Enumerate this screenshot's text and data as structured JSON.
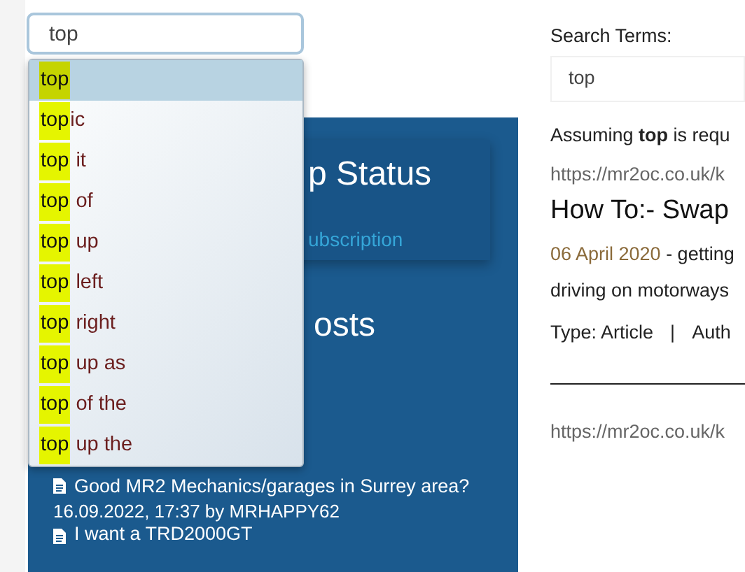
{
  "search": {
    "value": "top"
  },
  "suggestions": [
    {
      "match": "top",
      "selected": true
    },
    {
      "match": "top",
      "rest": "ic",
      "selected": false
    },
    {
      "match": "top",
      "rest": " it",
      "selected": false
    },
    {
      "match": "top",
      "rest": " of",
      "selected": false
    },
    {
      "match": "top",
      "rest": " up",
      "selected": false
    },
    {
      "match": "top",
      "rest": " left",
      "selected": false
    },
    {
      "match": "top",
      "rest": " right",
      "selected": false
    },
    {
      "match": "top",
      "rest": " up as",
      "selected": false
    },
    {
      "match": "top",
      "rest": " of the",
      "selected": false
    },
    {
      "match": "top",
      "rest": " up the",
      "selected": false
    }
  ],
  "membership": {
    "title": "p Status",
    "message": "ubscription"
  },
  "latest_posts": {
    "title": "osts",
    "posts": [
      {
        "title": "Good MR2 Mechanics/garages in Surrey area?",
        "meta": "16.09.2022, 17:37 by MRHAPPY62"
      },
      {
        "title": "I want a TRD2000GT"
      }
    ]
  },
  "results": {
    "label": "Search Terms:",
    "value": "top",
    "assumption": "Assuming **top** is requ",
    "items": [
      {
        "url": "https://mr2oc.co.uk/k",
        "title": "How To:- Swap",
        "date": "06 April 2020",
        "snippet_1": "- getting",
        "snippet_2": "driving on motorways",
        "type": "Type: Article",
        "separator": "|",
        "author": "Auth"
      },
      {
        "url": "https://mr2oc.co.uk/k"
      }
    ]
  }
}
